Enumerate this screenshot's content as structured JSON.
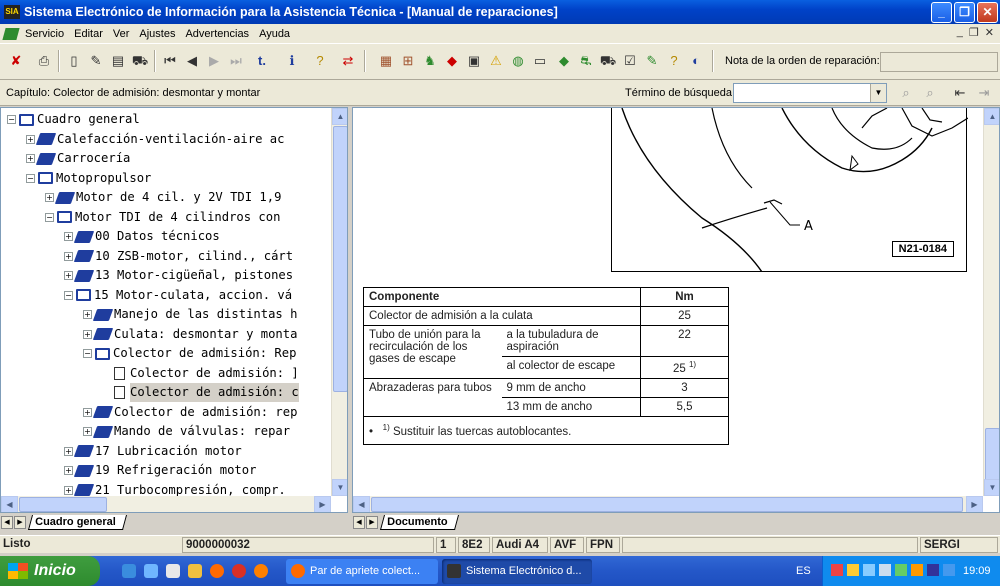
{
  "window": {
    "title": "Sistema Electrónico de Información para la Asistencia Técnica - [Manual de reparaciones]",
    "icon_text": "SIA"
  },
  "menu": [
    "Servicio",
    "Editar",
    "Ver",
    "Ajustes",
    "Advertencias",
    "Ayuda"
  ],
  "toolbar": {
    "order_label": "Nota de la orden de reparación:",
    "order_value": ""
  },
  "chapter": {
    "label": "Capítulo: Colector de admisión: desmontar y montar",
    "search_label": "Término de búsqueda:",
    "search_value": ""
  },
  "tree": [
    {
      "text": "Cuadro general",
      "level": 0,
      "exp": "−",
      "icon": "book-open"
    },
    {
      "text": "Calefacción-ventilación-aire ac",
      "level": 1,
      "exp": "+",
      "icon": "book"
    },
    {
      "text": "Carrocería",
      "level": 1,
      "exp": "+",
      "icon": "book"
    },
    {
      "text": "Motopropulsor",
      "level": 1,
      "exp": "−",
      "icon": "book-open"
    },
    {
      "text": "Motor de 4 cil. y 2V TDI 1,9",
      "level": 2,
      "exp": "+",
      "icon": "book"
    },
    {
      "text": "Motor TDI de 4 cilindros con",
      "level": 2,
      "exp": "−",
      "icon": "book-open"
    },
    {
      "text": "00 Datos técnicos",
      "level": 3,
      "exp": "+",
      "icon": "book"
    },
    {
      "text": "10 ZSB-motor, cilind., cárt",
      "level": 3,
      "exp": "+",
      "icon": "book"
    },
    {
      "text": "13 Motor-cigüeñal, pistones",
      "level": 3,
      "exp": "+",
      "icon": "book"
    },
    {
      "text": "15 Motor-culata, accion. vá",
      "level": 3,
      "exp": "−",
      "icon": "book-open"
    },
    {
      "text": "Manejo de las distintas h",
      "level": 4,
      "exp": "+",
      "icon": "book"
    },
    {
      "text": "Culata: desmontar y monta",
      "level": 4,
      "exp": "+",
      "icon": "book"
    },
    {
      "text": "Colector de admisión: Rep",
      "level": 4,
      "exp": "−",
      "icon": "book-open"
    },
    {
      "text": "Colector de admisión: ]",
      "level": 5,
      "exp": "",
      "icon": "doc"
    },
    {
      "text": "Colector de admisión: c",
      "level": 5,
      "exp": "",
      "icon": "doc",
      "selected": true
    },
    {
      "text": "Colector de admisión: rep",
      "level": 4,
      "exp": "+",
      "icon": "book"
    },
    {
      "text": "Mando de válvulas: repar",
      "level": 4,
      "exp": "+",
      "icon": "book"
    },
    {
      "text": "17 Lubricación motor",
      "level": 3,
      "exp": "+",
      "icon": "book"
    },
    {
      "text": "19 Refrigeración motor",
      "level": 3,
      "exp": "+",
      "icon": "book"
    },
    {
      "text": "21 Turbocompresión, compr.",
      "level": 3,
      "exp": "+",
      "icon": "book"
    }
  ],
  "left_tab": "Cuadro general",
  "right_tab": "Documento",
  "figure": {
    "label": "N21-0184",
    "callout": "A"
  },
  "table": {
    "h_component": "Componente",
    "h_nm": "Nm",
    "r1_comp": "Colector de admisión a la culata",
    "r1_nm": "25",
    "r2_comp": "Tubo de unión para la recirculación de los gases de escape",
    "r2a_sub": "a la tubuladura de aspiración",
    "r2a_nm": "22",
    "r2b_sub": "al colector de escape",
    "r2b_nm": "25",
    "r2b_sup": "1)",
    "r3_comp": "Abrazaderas para tubos",
    "r3a_sub": "9 mm de ancho",
    "r3a_nm": "3",
    "r3b_sub": "13 mm de ancho",
    "r3b_nm": "5,5",
    "foot_sup": "1)",
    "foot_text": "Sustituir las tuercas autoblocantes."
  },
  "status": {
    "ready": "Listo",
    "code": "9000000032",
    "f1": "1",
    "f2": "8E2",
    "f3": "Audi A4",
    "f4": "AVF",
    "f5": "FPN",
    "user": "SERGI"
  },
  "taskbar": {
    "start": "Inicio",
    "task1": "Par de apriete colect...",
    "task2": "Sistema Electrónico d...",
    "lang": "ES",
    "time": "19:09"
  }
}
